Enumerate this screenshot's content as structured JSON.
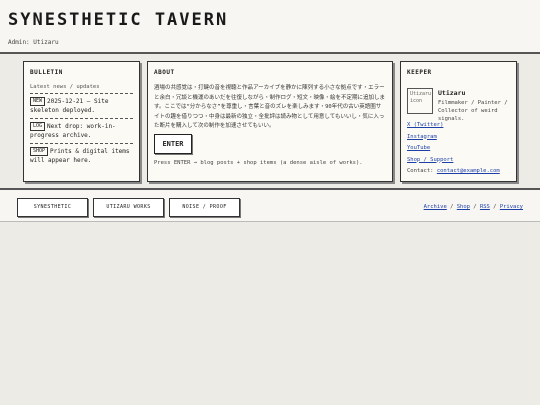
{
  "header": {
    "title": "SYNESTHETIC TAVERN",
    "admin": "Admin: Utizaru"
  },
  "bulletin": {
    "heading": "BULLETIN",
    "subtitle": "Latest news / updates",
    "items": [
      {
        "tag": "NEW",
        "text": "2025-12-21 — Site skeleton deployed."
      },
      {
        "tag": "LOG",
        "text": "Next drop: work-in-progress archive."
      },
      {
        "tag": "SHOP",
        "text": "Prints & digital items will appear here."
      }
    ]
  },
  "about": {
    "heading": "ABOUT",
    "text": "酒場の共感覚は・打鍵の音を視聴と作品アーカイブを静かに陳列する小さな拠点です・エラーと余白・冗談と機運のあいだを往復しながら・制作ログ・短文・映像・絵を不定期に追加します。ここでは“分からなさ”を尊重し・言葉と音のズレを楽しみます・90年代の古い英語圏サイトの趣を借りつつ・中身は最新の独立・全批評は読み物として用意してもいいし・気に入った断片を購入して次の制作を加速させてもいい。",
    "enter_label": "ENTER",
    "hint": "Press ENTER → blog posts + shop items (a dense aisle of works)."
  },
  "keeper": {
    "heading": "KEEPER",
    "avatar_alt": "Utizaru icon",
    "name": "Utizaru",
    "desc": "Filmmaker / Painter / Collector of weird signals.",
    "links": [
      "X (Twitter)",
      "Instagram",
      "YouTube",
      "Shop / Support"
    ],
    "contact_label": "Contact:",
    "contact_email": "contact@example.com"
  },
  "footer": {
    "buttons": [
      "SYNESTHETIC",
      "UTIZARU WORKS",
      "NOISE / PROOF"
    ],
    "links": [
      "Archive",
      "Shop",
      "RSS",
      "Privacy"
    ],
    "separator": " / "
  }
}
